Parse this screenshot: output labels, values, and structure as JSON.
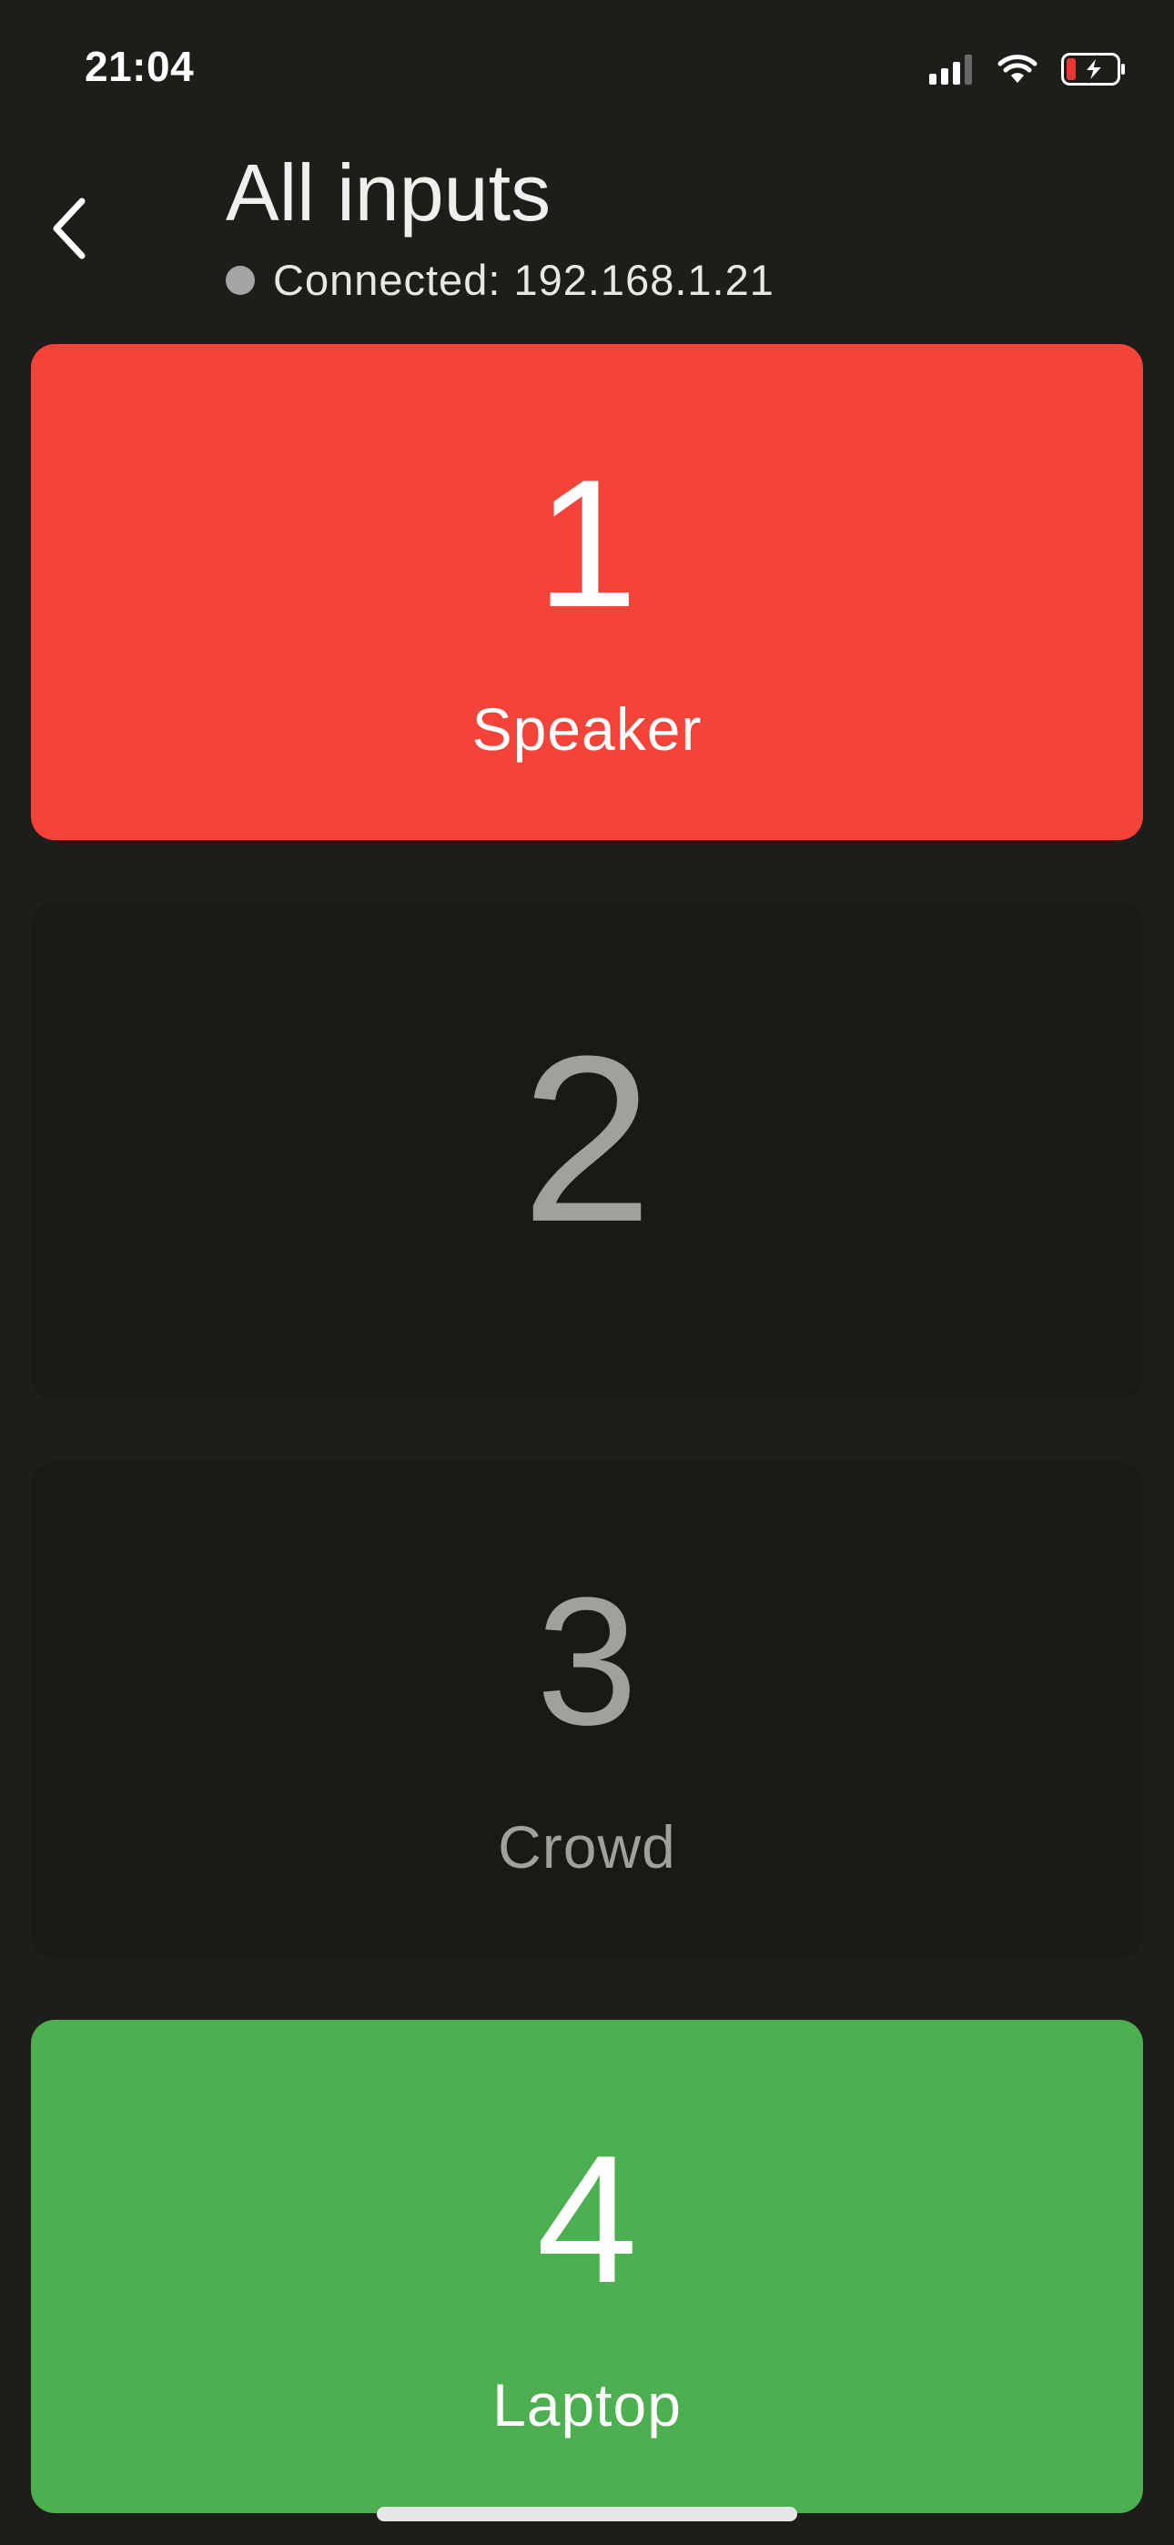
{
  "status_bar": {
    "time": "21:04",
    "icons": [
      "signal-icon",
      "wifi-icon",
      "battery-charging-icon"
    ],
    "battery_color": "#e53935"
  },
  "header": {
    "back_icon": "chevron-left-icon",
    "title": "All inputs",
    "connection_text": "Connected: 192.168.1.21",
    "status_dot_color": "#a4a4a4"
  },
  "inputs": [
    {
      "number": "1",
      "label": "Speaker",
      "color": "#f44339",
      "state": "active"
    },
    {
      "number": "2",
      "label": "",
      "color": "#1a1915",
      "state": "inactive"
    },
    {
      "number": "3",
      "label": "Crowd",
      "color": "#1a1915",
      "state": "inactive"
    },
    {
      "number": "4",
      "label": "Laptop",
      "color": "#4caf50",
      "state": "active"
    }
  ],
  "colors": {
    "background": "#1f1d1a",
    "inactive_text": "#a1a09d"
  }
}
